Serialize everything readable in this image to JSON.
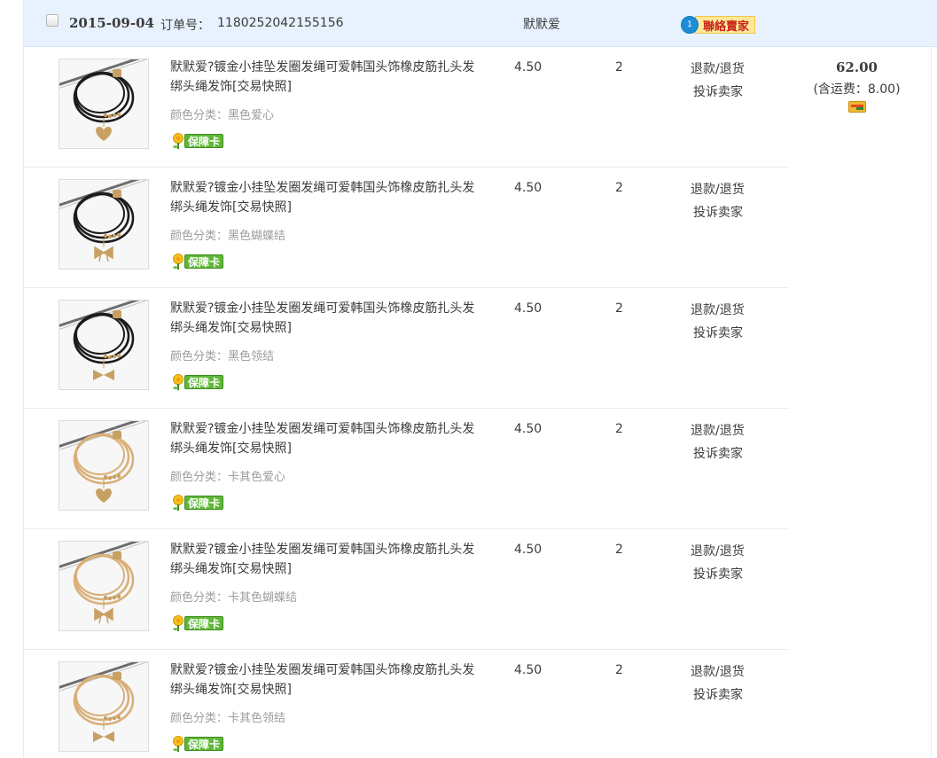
{
  "order": {
    "date": "2015-09-04",
    "order_no_label": "订单号：",
    "order_no": "1180252042155156",
    "seller": "默默爱",
    "contact_badge": "1",
    "contact_label": "聯絡賣家",
    "total": "62.00",
    "shipping": "(含运费：8.00)"
  },
  "items": [
    {
      "title": "默默爱?镀金小挂坠发圈发绳可爱韩国头饰橡皮筋扎头发绑头绳发饰[交易快照]",
      "sku_label": "颜色分类：",
      "sku_value": "黑色爱心",
      "guarantee": "保障卡",
      "price": "4.50",
      "qty": "2",
      "refund": "退款/退货",
      "complain": "投诉卖家",
      "color": "black",
      "charm": "heart"
    },
    {
      "title": "默默爱?镀金小挂坠发圈发绳可爱韩国头饰橡皮筋扎头发绑头绳发饰[交易快照]",
      "sku_label": "颜色分类：",
      "sku_value": "黑色蝴蝶结",
      "guarantee": "保障卡",
      "price": "4.50",
      "qty": "2",
      "refund": "退款/退货",
      "complain": "投诉卖家",
      "color": "black",
      "charm": "bow"
    },
    {
      "title": "默默爱?镀金小挂坠发圈发绳可爱韩国头饰橡皮筋扎头发绑头绳发饰[交易快照]",
      "sku_label": "颜色分类：",
      "sku_value": "黑色领结",
      "guarantee": "保障卡",
      "price": "4.50",
      "qty": "2",
      "refund": "退款/退货",
      "complain": "投诉卖家",
      "color": "black",
      "charm": "tie"
    },
    {
      "title": "默默爱?镀金小挂坠发圈发绳可爱韩国头饰橡皮筋扎头发绑头绳发饰[交易快照]",
      "sku_label": "颜色分类：",
      "sku_value": "卡其色爱心",
      "guarantee": "保障卡",
      "price": "4.50",
      "qty": "2",
      "refund": "退款/退货",
      "complain": "投诉卖家",
      "color": "khaki",
      "charm": "heart"
    },
    {
      "title": "默默爱?镀金小挂坠发圈发绳可爱韩国头饰橡皮筋扎头发绑头绳发饰[交易快照]",
      "sku_label": "颜色分类：",
      "sku_value": "卡其色蝴蝶结",
      "guarantee": "保障卡",
      "price": "4.50",
      "qty": "2",
      "refund": "退款/退货",
      "complain": "投诉卖家",
      "color": "khaki",
      "charm": "bow"
    },
    {
      "title": "默默爱?镀金小挂坠发圈发绳可爱韩国头饰橡皮筋扎头发绑头绳发饰[交易快照]",
      "sku_label": "颜色分类：",
      "sku_value": "卡其色领结",
      "guarantee": "保障卡",
      "price": "4.50",
      "qty": "2",
      "refund": "退款/退货",
      "complain": "投诉卖家",
      "color": "khaki",
      "charm": "tie"
    }
  ],
  "colors": {
    "header_bg": "#e8f2ff",
    "border": "#e3eef4",
    "text": "#3c3c3c",
    "muted": "#9c9c9c",
    "band_black": "#1c1c1c",
    "band_khaki": "#d9b07a",
    "gold": "#c9a063"
  }
}
